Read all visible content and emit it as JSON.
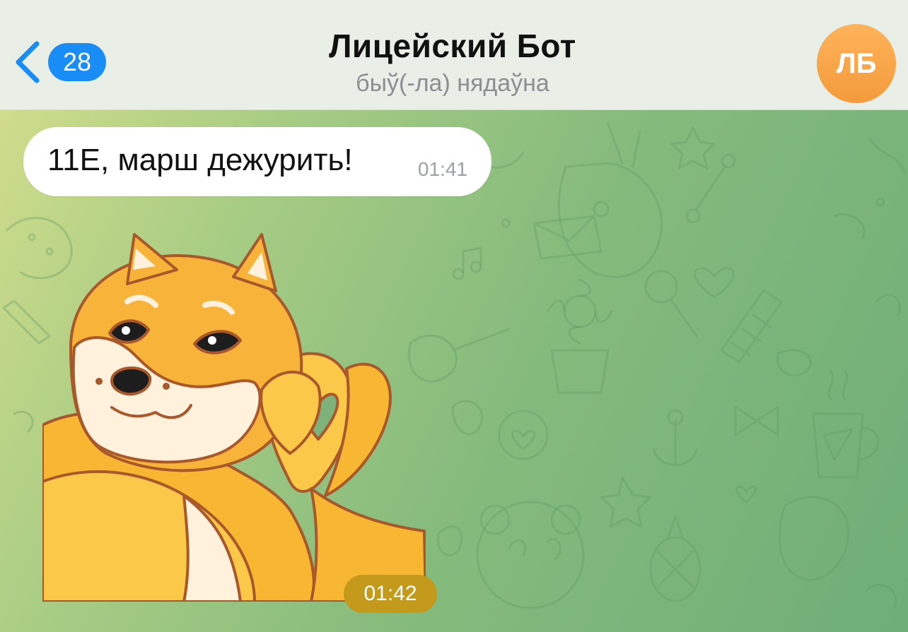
{
  "header": {
    "back_badge": "28",
    "title": "Лицейский Бот",
    "status": "быў(-ла) нядаўна",
    "avatar_initials": "ЛБ"
  },
  "messages": [
    {
      "type": "text",
      "text": "11E, марш дежурить!",
      "time": "01:41"
    },
    {
      "type": "sticker",
      "icon": "shiba-heart-sticker",
      "time": "01:42"
    }
  ],
  "colors": {
    "accent": "#1a8cf5",
    "avatar": "#f7a54a",
    "sticker_time_bg": "#c39a1b"
  }
}
